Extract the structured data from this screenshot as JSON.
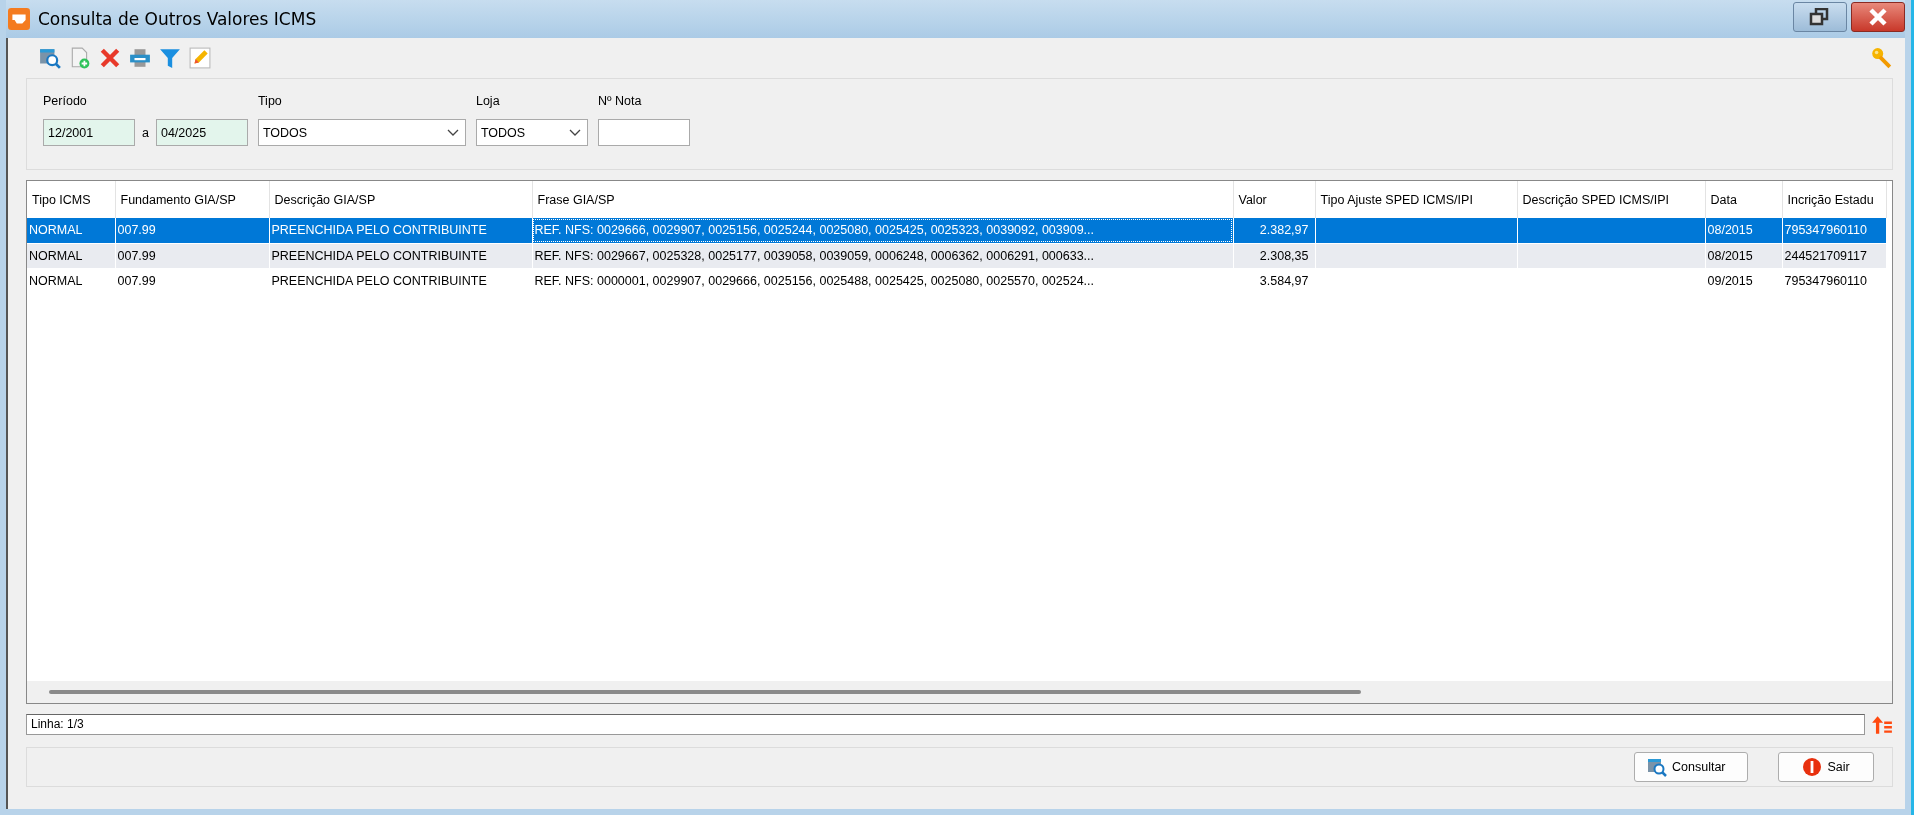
{
  "window": {
    "title": "Consulta de Outros Valores ICMS"
  },
  "filters": {
    "periodo": {
      "label": "Período",
      "from": "12/2001",
      "separator": "a",
      "to": "04/2025"
    },
    "tipo": {
      "label": "Tipo",
      "value": "TODOS"
    },
    "loja": {
      "label": "Loja",
      "value": "TODOS"
    },
    "nota": {
      "label": "Nº Nota"
    }
  },
  "table": {
    "columns": [
      "Tipo ICMS",
      "Fundamento GIA/SP",
      "Descrição GIA/SP",
      "Frase GIA/SP",
      "Valor",
      "Tipo Ajuste SPED ICMS/IPI",
      "Descrição SPED ICMS/IPI",
      "Data",
      "Incrição Estadu"
    ],
    "rows": [
      {
        "selected": true,
        "cells": [
          "NORMAL",
          "007.99",
          "PREENCHIDA PELO CONTRIBUINTE",
          "REF. NFS: 0029666, 0029907, 0025156, 0025244, 0025080, 0025425, 0025323, 0039092, 003909...",
          "2.382,97",
          "",
          "",
          "08/2015",
          "795347960110"
        ]
      },
      {
        "selected": false,
        "cells": [
          "NORMAL",
          "007.99",
          "PREENCHIDA PELO CONTRIBUINTE",
          "REF. NFS: 0029667, 0025328, 0025177, 0039058, 0039059, 0006248, 0006362, 0006291, 000633...",
          "2.308,35",
          "",
          "",
          "08/2015",
          "244521709117"
        ]
      },
      {
        "selected": false,
        "cells": [
          "NORMAL",
          "007.99",
          "PREENCHIDA PELO CONTRIBUINTE",
          "REF. NFS: 0000001, 0029907, 0029666, 0025156, 0025488, 0025425, 0025080, 0025570, 002524...",
          "3.584,97",
          "",
          "",
          "09/2015",
          "795347960110"
        ]
      }
    ]
  },
  "status_bar": {
    "text": "Linha: 1/3"
  },
  "buttons": [
    {
      "kind": "search",
      "label": "Consultar"
    },
    {
      "kind": "exit",
      "label": "Sair"
    }
  ]
}
